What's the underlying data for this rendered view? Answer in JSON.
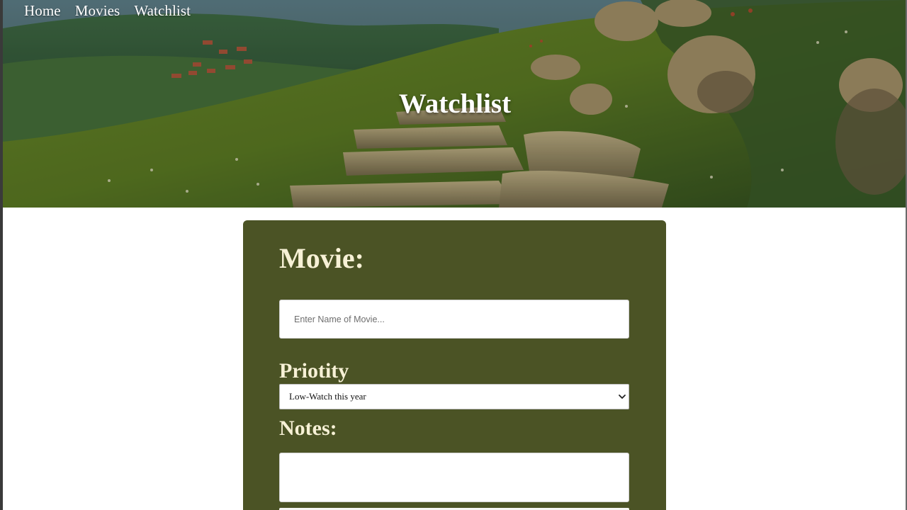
{
  "nav": {
    "items": [
      {
        "label": "Home"
      },
      {
        "label": "Movies"
      },
      {
        "label": "Watchlist"
      }
    ]
  },
  "hero": {
    "title": "Watchlist"
  },
  "form": {
    "movie_heading": "Movie:",
    "movie_placeholder": "Enter Name of Movie...",
    "priority_label": "Priotity",
    "priority_selected": "Low-Watch this year",
    "notes_label": "Notes:"
  },
  "colors": {
    "card_bg": "#4b5325",
    "heading_text": "#f7f1d6",
    "nav_text": "#ffffff"
  },
  "icons": {
    "select_arrow": "chevron-down-icon"
  }
}
